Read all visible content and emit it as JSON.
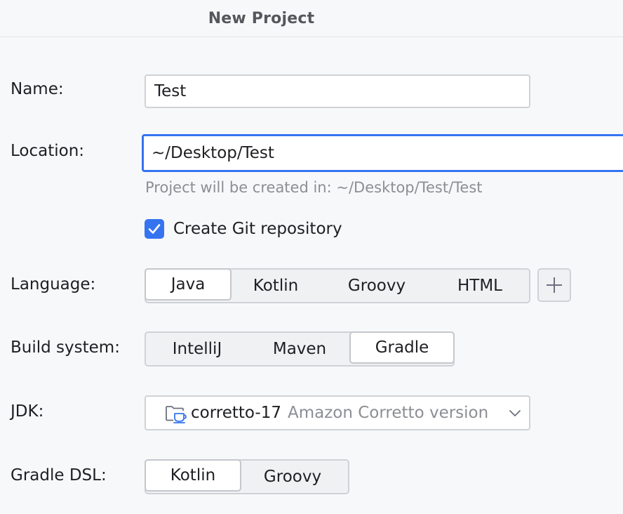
{
  "dialog": {
    "title": "New Project"
  },
  "name": {
    "label": "Name:",
    "value": "Test"
  },
  "location": {
    "label": "Location:",
    "value": "~/Desktop/Test",
    "hint": "Project will be created in: ~/Desktop/Test/Test"
  },
  "git": {
    "label": "Create Git repository",
    "checked": true
  },
  "language": {
    "label": "Language:",
    "options": [
      "Java",
      "Kotlin",
      "Groovy",
      "HTML"
    ],
    "selected": "Java",
    "add_icon": "plus-icon"
  },
  "build_system": {
    "label": "Build system:",
    "options": [
      "IntelliJ",
      "Maven",
      "Gradle"
    ],
    "selected": "Gradle"
  },
  "jdk": {
    "label": "JDK:",
    "name": "corretto-17",
    "description": "Amazon Corretto version",
    "icon": "jdk-folder-icon"
  },
  "gradle_dsl": {
    "label": "Gradle DSL:",
    "options": [
      "Kotlin",
      "Groovy"
    ],
    "selected": "Kotlin"
  },
  "colors": {
    "accent": "#3574f0",
    "hint": "#8c8e94",
    "background": "#f7f8fa"
  }
}
